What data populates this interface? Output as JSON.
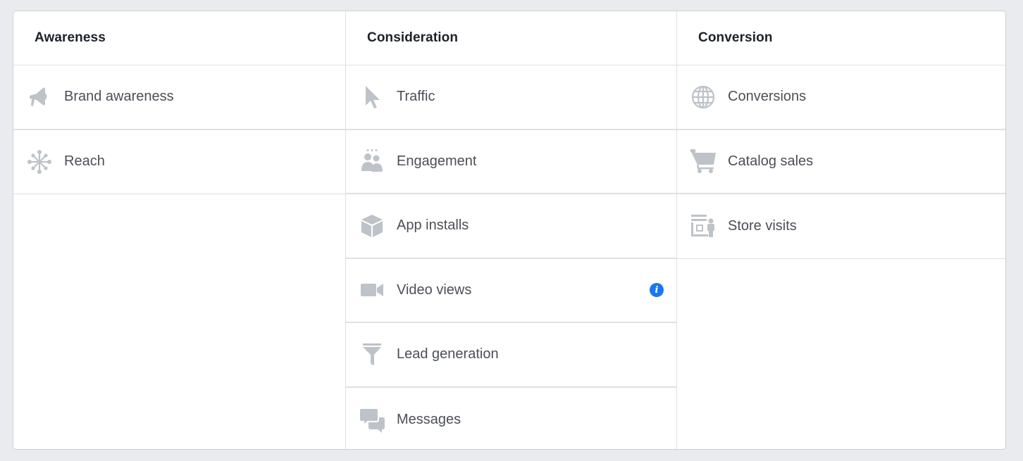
{
  "columns": [
    {
      "header": "Awareness",
      "items": [
        {
          "label": "Brand awareness",
          "icon": "megaphone-icon"
        },
        {
          "label": "Reach",
          "icon": "reach-icon"
        }
      ]
    },
    {
      "header": "Consideration",
      "items": [
        {
          "label": "Traffic",
          "icon": "cursor-icon"
        },
        {
          "label": "Engagement",
          "icon": "people-icon"
        },
        {
          "label": "App installs",
          "icon": "box-icon"
        },
        {
          "label": "Video views",
          "icon": "video-camera-icon",
          "info": "i"
        },
        {
          "label": "Lead generation",
          "icon": "funnel-icon"
        },
        {
          "label": "Messages",
          "icon": "chat-bubbles-icon"
        }
      ]
    },
    {
      "header": "Conversion",
      "items": [
        {
          "label": "Conversions",
          "icon": "globe-icon"
        },
        {
          "label": "Catalog sales",
          "icon": "shopping-cart-icon"
        },
        {
          "label": "Store visits",
          "icon": "store-icon"
        }
      ]
    }
  ],
  "colors": {
    "background": "#e9ebee",
    "icon": "#bec3c9",
    "info": "#1877f2",
    "label": "#4b4f56",
    "header": "#1d2129"
  }
}
